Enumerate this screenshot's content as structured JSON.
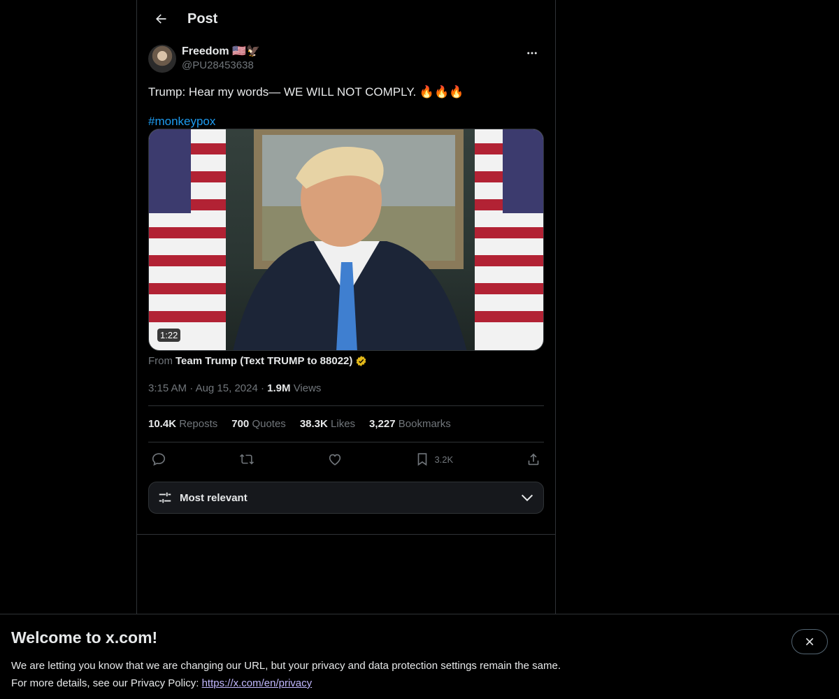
{
  "header": {
    "title": "Post"
  },
  "post": {
    "author_name": "Freedom 🇺🇸🦅",
    "author_handle": "@PU28453638",
    "text": "Trump: Hear my words— WE WILL NOT COMPLY. 🔥🔥🔥",
    "hashtag": "#monkeypox",
    "video_duration": "1:22",
    "from_prefix": "From",
    "from_source": "Team Trump (Text TRUMP to 88022)",
    "time": "3:15 AM",
    "date": "Aug 15, 2024",
    "views_count": "1.9M",
    "views_label": "Views"
  },
  "stats": {
    "reposts_count": "10.4K",
    "reposts_label": "Reposts",
    "quotes_count": "700",
    "quotes_label": "Quotes",
    "likes_count": "38.3K",
    "likes_label": "Likes",
    "bookmarks_count": "3,227",
    "bookmarks_label": "Bookmarks"
  },
  "actions": {
    "bookmark_count": "3.2K"
  },
  "sort": {
    "label": "Most relevant"
  },
  "banner": {
    "title": "Welcome to x.com!",
    "line1": "We are letting you know that we are changing our URL, but your privacy and data protection settings remain the same.",
    "line2_prefix": "For more details, see our Privacy Policy: ",
    "link": "https://x.com/en/privacy"
  },
  "colors": {
    "accent": "#1d9bf0",
    "border": "#2f3336",
    "muted": "#71767b",
    "verified": "#e2b719"
  }
}
